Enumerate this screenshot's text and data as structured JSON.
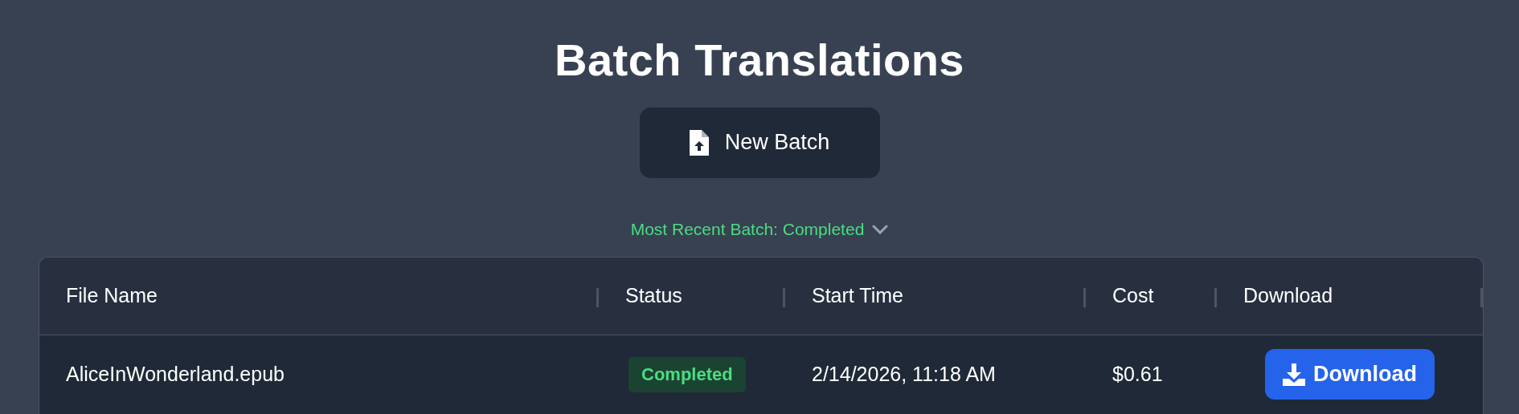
{
  "title": "Batch Translations",
  "new_batch_button": {
    "label": "New Batch"
  },
  "recent_batch": {
    "label": "Most Recent Batch: Completed",
    "expanded": false
  },
  "table": {
    "columns": [
      "File Name",
      "Status",
      "Start Time",
      "Cost",
      "Download"
    ],
    "rows": [
      {
        "file_name": "AliceInWonderland.epub",
        "status": {
          "label": "Completed",
          "color": "#4ade80"
        },
        "start_time": "2/14/2026, 11:18 AM",
        "cost": "$0.61",
        "download": "Download"
      }
    ]
  }
}
